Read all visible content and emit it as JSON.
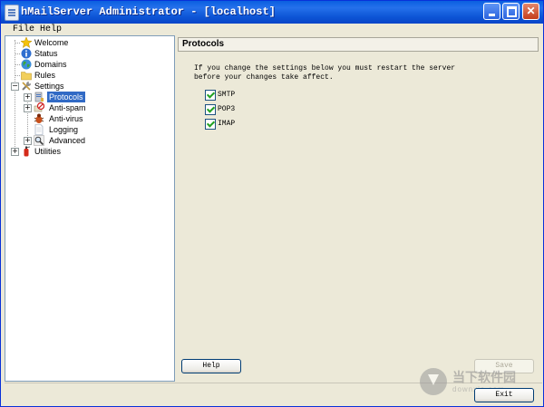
{
  "window": {
    "title": "hMailServer Administrator - [localhost]"
  },
  "menu": [
    "File",
    "Help"
  ],
  "tree": {
    "items": [
      {
        "label": "Welcome",
        "icon": "star-icon"
      },
      {
        "label": "Status",
        "icon": "info-icon"
      },
      {
        "label": "Domains",
        "icon": "globe-icon"
      },
      {
        "label": "Rules",
        "icon": "folder-icon"
      },
      {
        "label": "Settings",
        "icon": "tools-icon"
      },
      {
        "label": "Protocols",
        "icon": "server-icon"
      },
      {
        "label": "Anti-spam",
        "icon": "no-spam-icon"
      },
      {
        "label": "Anti-virus",
        "icon": "bug-icon"
      },
      {
        "label": "Logging",
        "icon": "document-icon"
      },
      {
        "label": "Advanced",
        "icon": "magnifier-icon"
      },
      {
        "label": "Utilities",
        "icon": "fire-extinguisher-icon"
      }
    ],
    "selected": "Protocols"
  },
  "panel": {
    "title": "Protocols",
    "info_line1": "If you change the settings below you must restart the server",
    "info_line2": "before your changes take affect.",
    "protocols": [
      {
        "label": "SMTP",
        "checked": true
      },
      {
        "label": "POP3",
        "checked": true
      },
      {
        "label": "IMAP",
        "checked": true
      }
    ]
  },
  "buttons": {
    "help": "Help",
    "save": "Save",
    "exit": "Exit"
  },
  "watermark": {
    "text": "当下软件园",
    "sub": "downxia.com"
  },
  "colors": {
    "titlebar": "#0a5fe0",
    "selection": "#316ac5",
    "check": "#21a121"
  }
}
